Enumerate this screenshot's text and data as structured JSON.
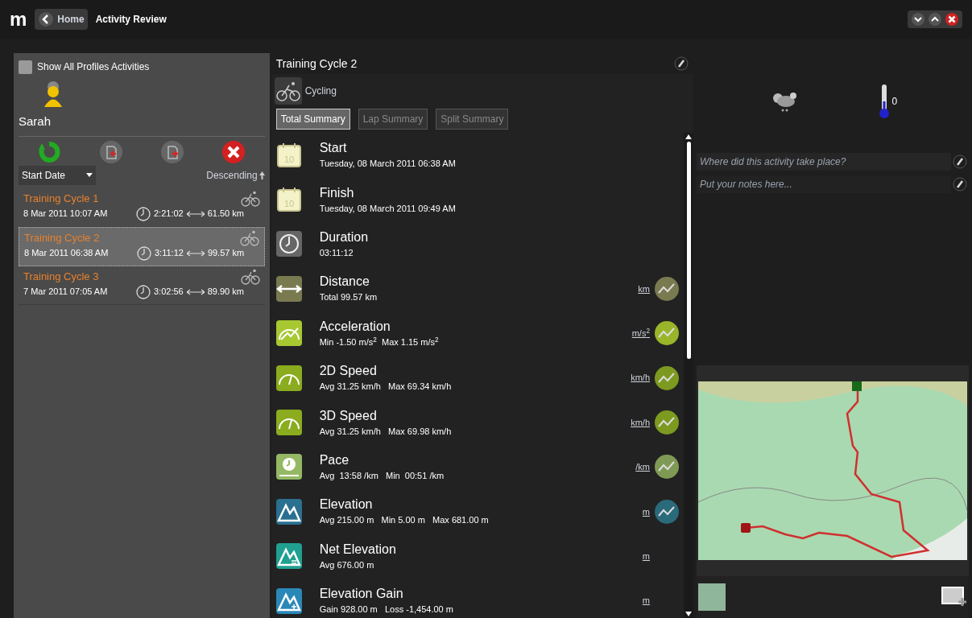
{
  "header": {
    "logo": "m",
    "back_label": "Home",
    "title": "Activity Review"
  },
  "sidebar": {
    "show_all": {
      "label": "Show All Profiles Activities",
      "checked": false
    },
    "profile_name": "Sarah",
    "sort": {
      "field": "Start Date",
      "order": "Descending"
    },
    "activities": [
      {
        "name": "Training Cycle 1",
        "date": "8 Mar 2011 10:07 AM",
        "duration": "2:21:02",
        "distance": "61.50 km",
        "selected": false
      },
      {
        "name": "Training Cycle 2",
        "date": "8 Mar 2011 06:38 AM",
        "duration": "3:11:12",
        "distance": "99.57 km",
        "selected": true
      },
      {
        "name": "Training Cycle 3",
        "date": "7 Mar 2011 07:05 AM",
        "duration": "3:02:56",
        "distance": "89.90 km",
        "selected": false
      }
    ]
  },
  "detail": {
    "title": "Training Cycle 2",
    "sport": "Cycling",
    "tabs": [
      {
        "label": "Total Summary",
        "selected": true
      },
      {
        "label": "Lap Summary",
        "selected": false
      },
      {
        "label": "Split Summary",
        "selected": false
      }
    ],
    "metrics": [
      {
        "kind": "calendar",
        "day": "10",
        "label": "Start",
        "value": "Tuesday, 08 March 2011 06:38 AM"
      },
      {
        "kind": "calendar",
        "day": "10",
        "label": "Finish",
        "value": "Tuesday, 08 March 2011 09:49 AM"
      },
      {
        "kind": "clock",
        "label": "Duration",
        "value": "03:11:12"
      },
      {
        "kind": "distance",
        "label": "Distance",
        "value": "Total 99.57 km",
        "unit": "km",
        "chart": true
      },
      {
        "kind": "acceleration",
        "label": "Acceleration",
        "value": "Min -1.50 m/s$^{2}$  Max 1.15 m/s$^{2}$",
        "unit": "m/s$^{2}$",
        "chart": true
      },
      {
        "kind": "speed",
        "label": "2D Speed",
        "value": "Avg 31.25 km/h   Max 69.34 km/h",
        "unit": "km/h",
        "chart": true
      },
      {
        "kind": "speed",
        "label": "3D Speed",
        "value": "Avg 31.25 km/h   Max 69.98 km/h",
        "unit": "km/h",
        "chart": true
      },
      {
        "kind": "pace",
        "label": "Pace",
        "value": "Avg  13:58 /km   Min  00:51 /km",
        "unit": "/km",
        "chart": true
      },
      {
        "kind": "elevation",
        "label": "Elevation",
        "value": "Avg 215.00 m   Min 5.00 m   Max 681.00 m",
        "unit": "m",
        "chart": true
      },
      {
        "kind": "net_elevation",
        "label": "Net Elevation",
        "value": "Avg 676.00 m",
        "unit": "m",
        "chart": false
      },
      {
        "kind": "elevation_gain",
        "label": "Elevation Gain",
        "value": "Gain 928.00 m   Loss -1,454.00 m",
        "unit": "m",
        "chart": false
      }
    ]
  },
  "info": {
    "temperature": "0",
    "location": {
      "placeholder": "Where did this activity take place?"
    },
    "notes": {
      "placeholder": "Put your notes here..."
    }
  }
}
